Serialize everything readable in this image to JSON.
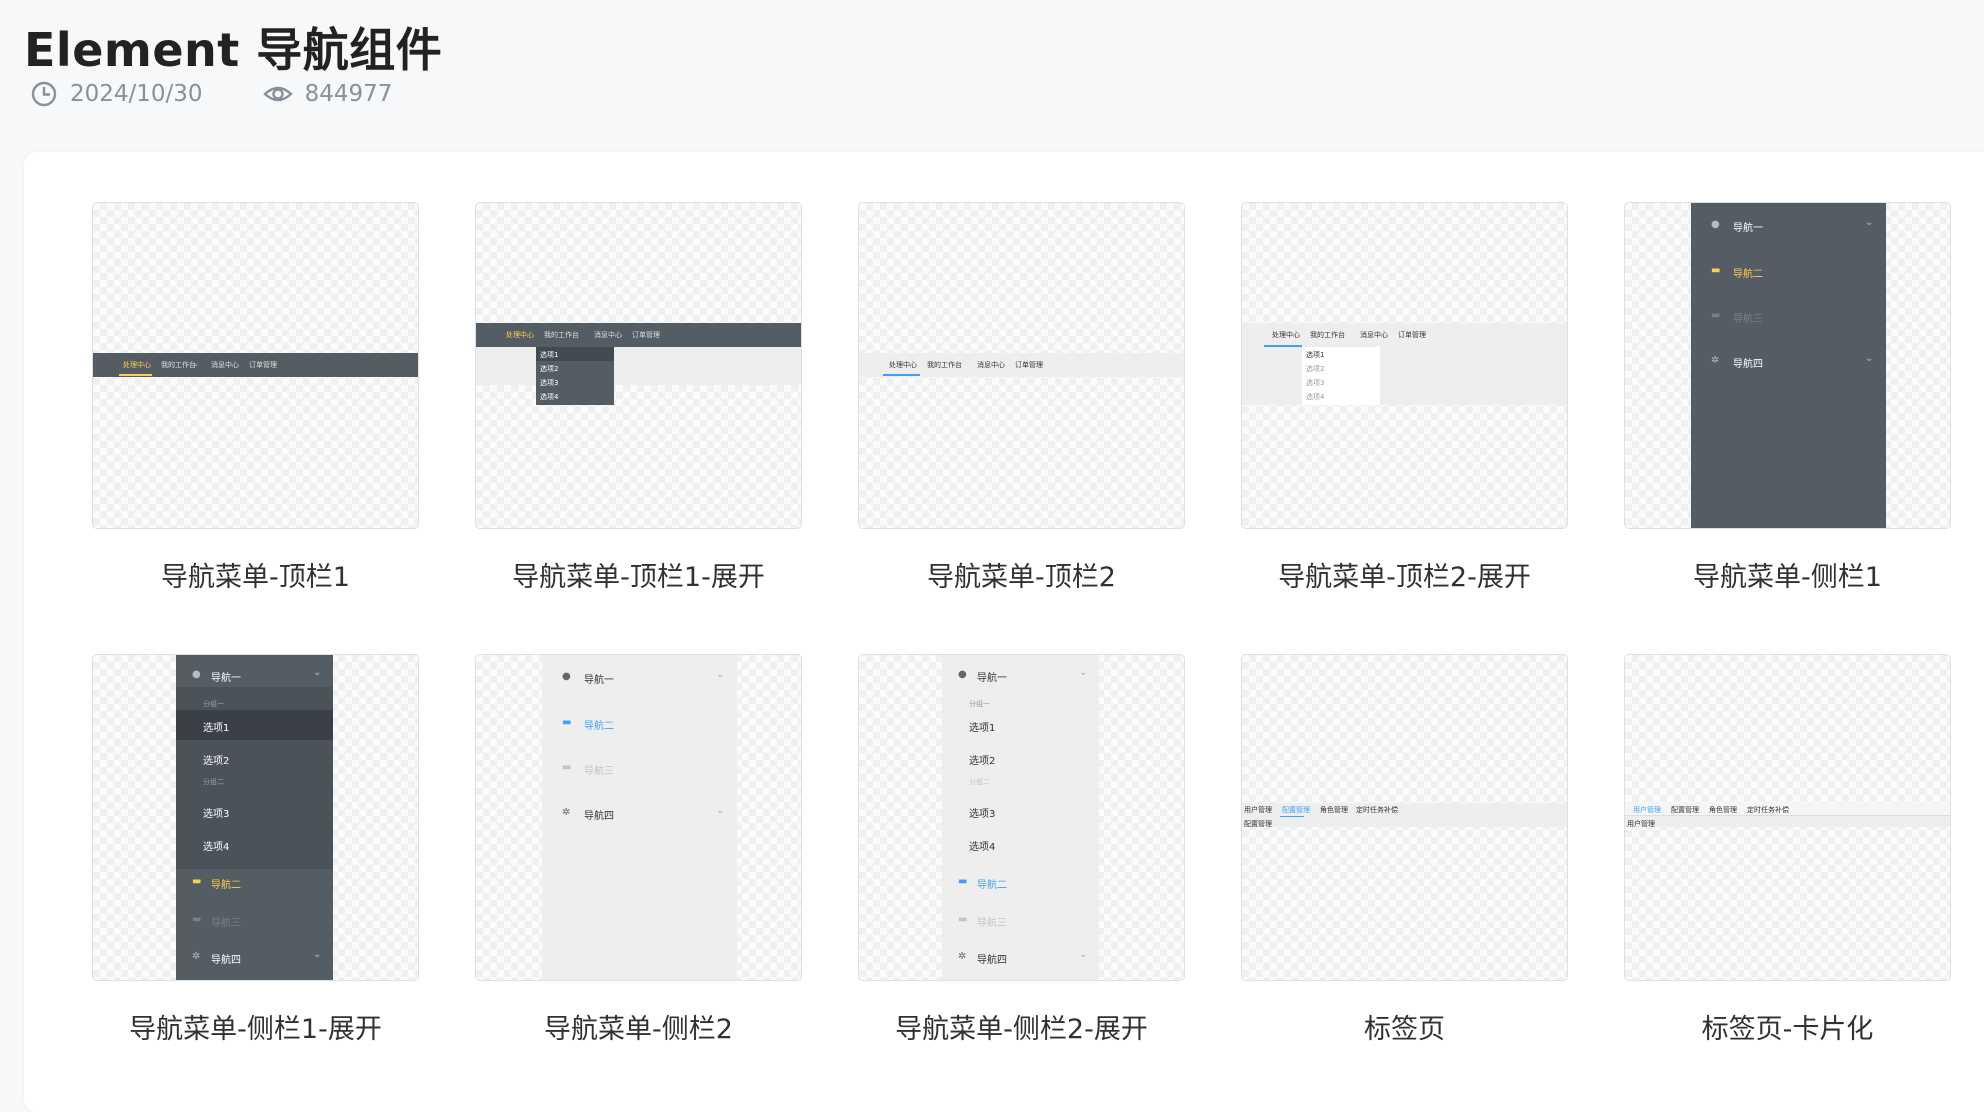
{
  "page": {
    "title": "Element 导航组件",
    "date": "2024/10/30",
    "views": "844977"
  },
  "icons": {
    "date": "clock-icon",
    "views": "eye-icon"
  },
  "colors": {
    "dark_menu": "#545c64",
    "active_yellow": "#ffd04b",
    "active_blue": "#409eff",
    "light_menu": "#eeeeee"
  },
  "cards": [
    {
      "caption": "导航菜单-顶栏1"
    },
    {
      "caption": "导航菜单-顶栏1-展开"
    },
    {
      "caption": "导航菜单-顶栏2"
    },
    {
      "caption": "导航菜单-顶栏2-展开"
    },
    {
      "caption": "导航菜单-侧栏1"
    },
    {
      "caption": "导航菜单-侧栏1-展开"
    },
    {
      "caption": "导航菜单-侧栏2"
    },
    {
      "caption": "导航菜单-侧栏2-展开"
    },
    {
      "caption": "标签页"
    },
    {
      "caption": "标签页-卡片化"
    }
  ],
  "top_menu": [
    "处理中心",
    "我的工作台",
    "消息中心",
    "订单管理"
  ],
  "top_menu_options": [
    "选项1",
    "选项2",
    "选项3",
    "选项4"
  ],
  "side_menu": {
    "nav1": "导航一",
    "nav2": "导航二",
    "nav3": "导航三",
    "nav4": "导航四",
    "group1": "分组一",
    "group2": "分组二",
    "options": [
      "选项1",
      "选项2",
      "选项3",
      "选项4"
    ]
  },
  "tabs": [
    "用户管理",
    "配置管理",
    "角色管理",
    "定时任务补偿"
  ],
  "tab_content": {
    "config": "配置管理",
    "user": "用户管理"
  }
}
